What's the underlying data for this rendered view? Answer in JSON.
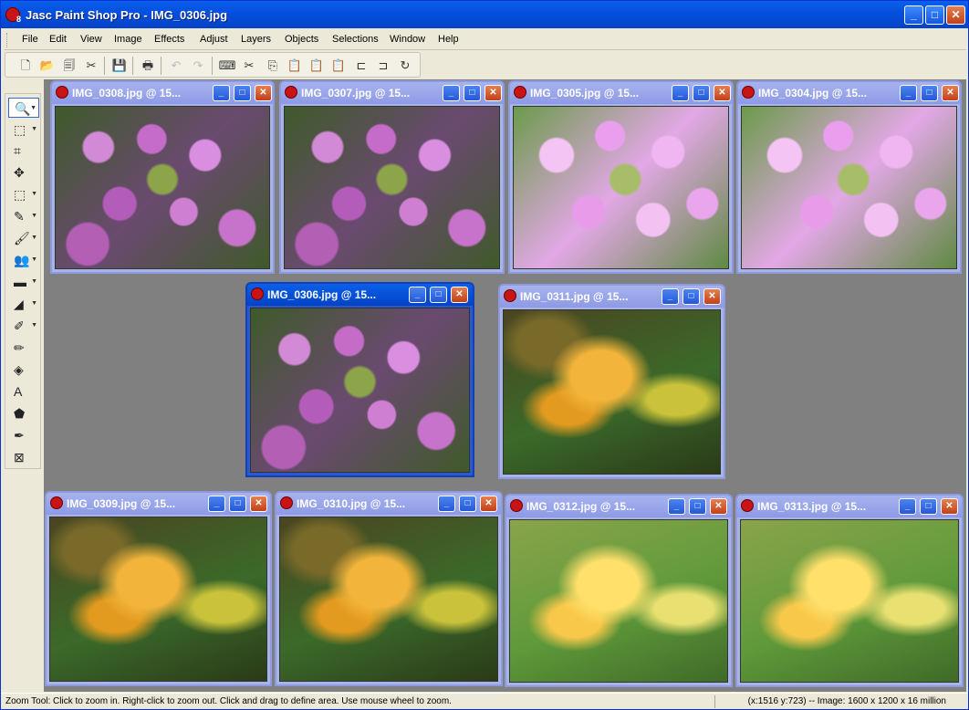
{
  "window": {
    "title": "Jasc Paint Shop Pro - IMG_0306.jpg",
    "icon_badge": "8"
  },
  "menu": [
    "File",
    "Edit",
    "View",
    "Image",
    "Effects",
    "Adjust",
    "Layers",
    "Objects",
    "Selections",
    "Window",
    "Help"
  ],
  "toolbar": [
    {
      "name": "new-icon",
      "glyph": "🗋"
    },
    {
      "name": "open-icon",
      "glyph": "📂"
    },
    {
      "name": "browse-icon",
      "glyph": "🗐"
    },
    {
      "name": "scan-icon",
      "glyph": "✂"
    },
    {
      "name": "save-icon",
      "glyph": "💾"
    },
    {
      "name": "print-icon",
      "glyph": "🖶"
    },
    {
      "name": "undo-icon",
      "glyph": "↶"
    },
    {
      "name": "redo-icon",
      "glyph": "↷"
    },
    {
      "name": "show-hide-icon",
      "glyph": "⌨"
    },
    {
      "name": "cut-icon",
      "glyph": "✂"
    },
    {
      "name": "copy-icon",
      "glyph": "⎘"
    },
    {
      "name": "paste-icon",
      "glyph": "📋"
    },
    {
      "name": "paste-layer-icon",
      "glyph": "📋"
    },
    {
      "name": "paste-selection-icon",
      "glyph": "📋"
    },
    {
      "name": "crop-to-selection-icon",
      "glyph": "⊏"
    },
    {
      "name": "resize-icon",
      "glyph": "⊐"
    },
    {
      "name": "rotate-icon",
      "glyph": "↻"
    }
  ],
  "tools": [
    {
      "name": "zoom-tool-icon",
      "glyph": "🔍",
      "caret": true
    },
    {
      "name": "pick-tool-icon",
      "glyph": "⬚",
      "caret": true
    },
    {
      "name": "crop-tool-icon",
      "glyph": "⌗",
      "caret": false
    },
    {
      "name": "move-tool-icon",
      "glyph": "✥",
      "caret": false
    },
    {
      "name": "selection-tool-icon",
      "glyph": "⬚",
      "caret": true
    },
    {
      "name": "dropper-tool-icon",
      "glyph": "✎",
      "caret": true
    },
    {
      "name": "brush-tool-icon",
      "glyph": "🖌",
      "caret": true
    },
    {
      "name": "clone-tool-icon",
      "glyph": "👥",
      "caret": true
    },
    {
      "name": "scratch-remover-icon",
      "glyph": "▬",
      "caret": true
    },
    {
      "name": "dodge-tool-icon",
      "glyph": "◢",
      "caret": true
    },
    {
      "name": "eraser-tool-icon",
      "glyph": "✐",
      "caret": true
    },
    {
      "name": "picture-tube-icon",
      "glyph": "✏",
      "caret": false
    },
    {
      "name": "fill-tool-icon",
      "glyph": "◈",
      "caret": false
    },
    {
      "name": "text-tool-icon",
      "glyph": "A",
      "caret": false
    },
    {
      "name": "shape-tool-icon",
      "glyph": "⬟",
      "caret": false
    },
    {
      "name": "pen-tool-icon",
      "glyph": "✒",
      "caret": false
    },
    {
      "name": "warp-tool-icon",
      "glyph": "⊠",
      "caret": false
    }
  ],
  "image_windows": [
    {
      "title": "IMG_0308.jpg @  15...",
      "photo": "purple",
      "active": false
    },
    {
      "title": "IMG_0307.jpg @  15...",
      "photo": "purple",
      "active": false
    },
    {
      "title": "IMG_0305.jpg @  15...",
      "photo": "pink",
      "active": false
    },
    {
      "title": "IMG_0304.jpg @  15...",
      "photo": "pink",
      "active": false
    },
    {
      "title": "IMG_0306.jpg @  15...",
      "photo": "purple",
      "active": true
    },
    {
      "title": "IMG_0311.jpg @  15...",
      "photo": "yellow",
      "active": false
    },
    {
      "title": "IMG_0309.jpg @  15...",
      "photo": "yellow",
      "active": false
    },
    {
      "title": "IMG_0310.jpg @  15...",
      "photo": "yellow",
      "active": false
    },
    {
      "title": "IMG_0312.jpg @  15...",
      "photo": "yellow-light",
      "active": false
    },
    {
      "title": "IMG_0313.jpg @  15...",
      "photo": "yellow-light",
      "active": false
    }
  ],
  "window_buttons": {
    "minimize": "_",
    "maximize": "□",
    "close": "✕"
  },
  "status": {
    "left": "Zoom Tool: Click to zoom in. Right-click to zoom out. Click and drag to define area. Use mouse wheel to zoom.",
    "right": "(x:1516 y:723) -- Image:  1600 x 1200 x 16 million"
  },
  "colors": {
    "title_active": "#0a5fe9",
    "title_inactive": "#a7b3ee",
    "workspace": "#808080"
  }
}
